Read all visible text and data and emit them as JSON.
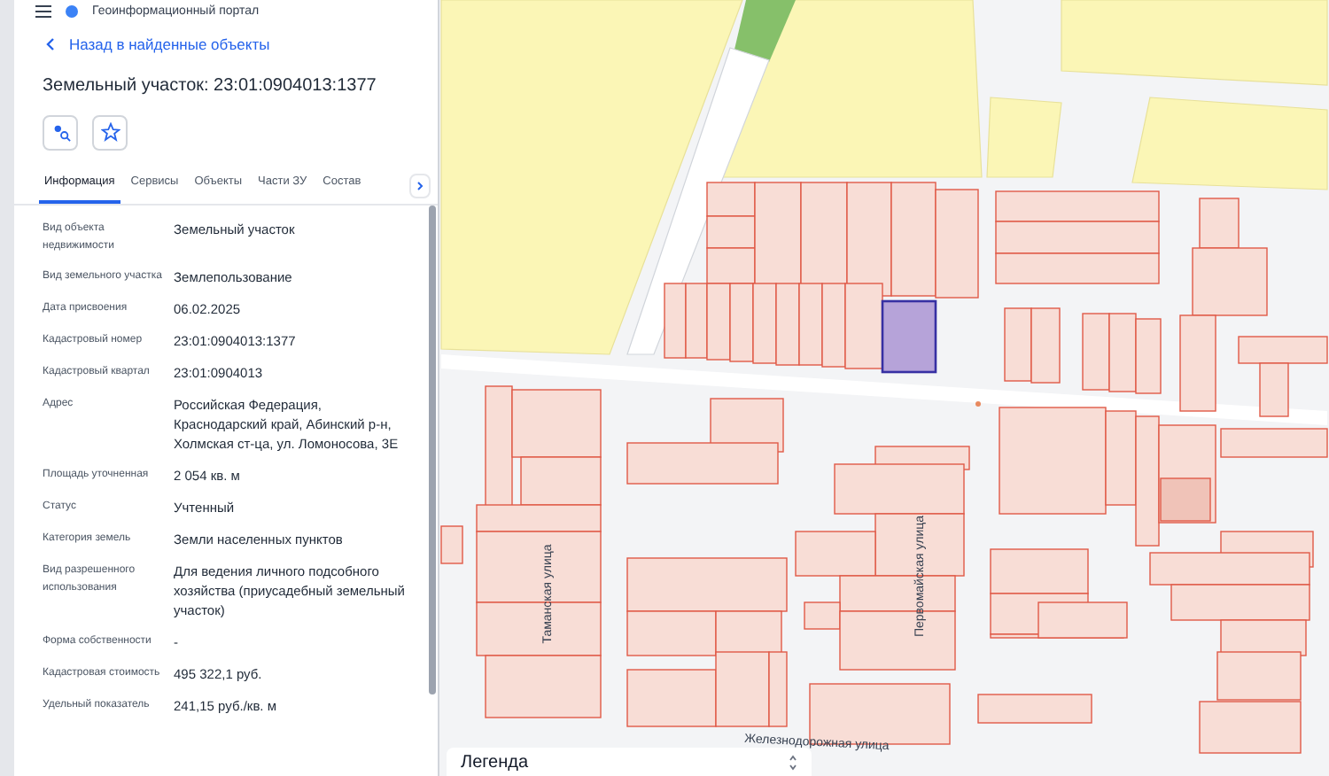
{
  "header": {
    "title": "Геоинформационный портал"
  },
  "back_link": "Назад в найденные объекты",
  "title": "Земельный участок: 23:01:0904013:1377",
  "tabs": [
    {
      "label": "Информация",
      "selected": true
    },
    {
      "label": "Сервисы",
      "selected": false
    },
    {
      "label": "Объекты",
      "selected": false
    },
    {
      "label": "Части ЗУ",
      "selected": false
    },
    {
      "label": "Состав",
      "selected": false
    }
  ],
  "properties": [
    {
      "label": "Вид объекта недвижимости",
      "value": "Земельный участок"
    },
    {
      "label": "Вид земельного участка",
      "value": "Землепользование"
    },
    {
      "label": "Дата присвоения",
      "value": "06.02.2025"
    },
    {
      "label": "Кадастровый номер",
      "value": "23:01:0904013:1377"
    },
    {
      "label": "Кадастровый квартал",
      "value": "23:01:0904013"
    },
    {
      "label": "Адрес",
      "value": "Российская Федерация, Краснодарский край, Абинский р-н, Холмская ст-ца, ул. Ломоносова, 3Е"
    },
    {
      "label": "Площадь уточненная",
      "value": "2 054 кв. м"
    },
    {
      "label": "Статус",
      "value": "Учтенный"
    },
    {
      "label": "Категория земель",
      "value": "Земли населенных пунктов"
    },
    {
      "label": "Вид разрешенного использования",
      "value": "Для ведения личного подсобного хозяйства (приусадебный земельный участок)"
    },
    {
      "label": "Форма собственности",
      "value": "-"
    },
    {
      "label": "Кадастровая стоимость",
      "value": "495 322,1 руб."
    },
    {
      "label": "Удельный показатель",
      "value": "241,15 руб./кв. м"
    }
  ],
  "map": {
    "streets": [
      {
        "name": "Таманская улица",
        "kind": "vertical"
      },
      {
        "name": "Первомайская улица",
        "kind": "vertical"
      },
      {
        "name": "Железнодорожная улица",
        "kind": "horizontal"
      }
    ],
    "legend": {
      "title": "Легенда"
    }
  }
}
